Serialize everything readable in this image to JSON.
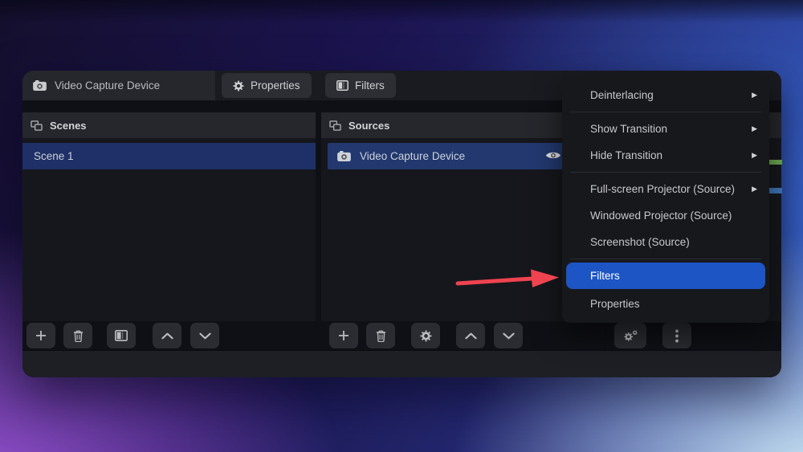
{
  "topbar": {
    "source_label": "Video Capture Device",
    "properties_button": "Properties",
    "filters_button": "Filters"
  },
  "scenes_panel": {
    "title": "Scenes",
    "rows": [
      {
        "label": "Scene 1",
        "selected": true
      }
    ]
  },
  "sources_panel": {
    "title": "Sources",
    "rows": [
      {
        "label": "Video Capture Device",
        "selected": true,
        "visible": true
      }
    ]
  },
  "context_menu": {
    "items": [
      {
        "label": "Deinterlacing",
        "submenu": true
      },
      {
        "type": "separator"
      },
      {
        "label": "Show Transition",
        "submenu": true
      },
      {
        "label": "Hide Transition",
        "submenu": true
      },
      {
        "type": "separator"
      },
      {
        "label": "Full-screen Projector (Source)",
        "submenu": true
      },
      {
        "label": "Windowed Projector (Source)"
      },
      {
        "label": "Screenshot (Source)"
      },
      {
        "type": "separator"
      },
      {
        "label": "Filters",
        "highlighted": true
      },
      {
        "label": "Properties"
      }
    ]
  },
  "icons": {
    "submenu_arrow": "▶"
  },
  "colors": {
    "accent_blue": "#1d55c4",
    "selected_scene_row": "#1e3067",
    "selected_source_row": "#22386f",
    "arrow_red": "#ef4350",
    "meter_green": "#6aa84f",
    "meter_blue": "#3f76b6"
  }
}
